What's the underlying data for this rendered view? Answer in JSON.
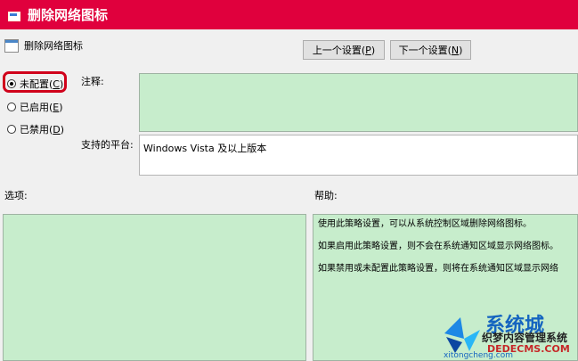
{
  "window": {
    "title": "删除网络图标"
  },
  "header": {
    "policy_name": "删除网络图标"
  },
  "nav": {
    "prev": {
      "label": "上一个设置(",
      "key": "P",
      "suffix": ")"
    },
    "next": {
      "label": "下一个设置(",
      "key": "N",
      "suffix": ")"
    }
  },
  "radios": [
    {
      "label": "未配置(",
      "key": "C",
      "suffix": ")",
      "checked": true
    },
    {
      "label": "已启用(",
      "key": "E",
      "suffix": ")",
      "checked": false
    },
    {
      "label": "已禁用(",
      "key": "D",
      "suffix": ")",
      "checked": false
    }
  ],
  "comment": {
    "label": "注释:",
    "value": ""
  },
  "supported": {
    "label": "支持的平台:",
    "value": "Windows Vista 及以上版本"
  },
  "options": {
    "label": "选项:"
  },
  "help": {
    "label": "帮助:",
    "paragraphs": [
      "使用此策略设置，可以从系统控制区域删除网络图标。",
      "如果启用此策略设置，则不会在系统通知区域显示网络图标。",
      "如果禁用或未配置此策略设置，则将在系统通知区域显示网络"
    ]
  },
  "watermark": {
    "brand": "系统城",
    "line2": "织梦内容管理系统",
    "line3": "DEDECMS.COM",
    "line4": "xitongcheng.com"
  },
  "colors": {
    "titlebar": "#e0003d",
    "policy_box": "#c7edcc",
    "highlight": "#d0021b"
  }
}
